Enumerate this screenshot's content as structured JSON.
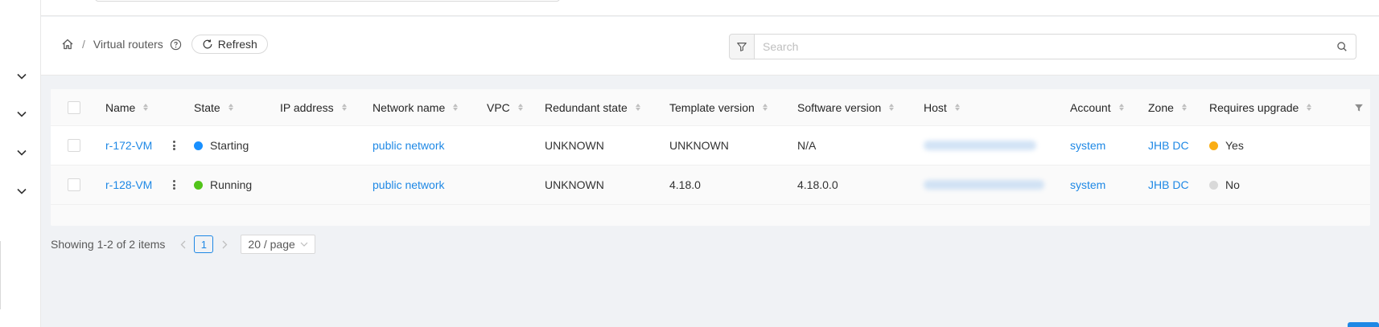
{
  "breadcrumb": {
    "page": "Virtual routers"
  },
  "header": {
    "refresh_label": "Refresh"
  },
  "search": {
    "placeholder": "Search"
  },
  "table": {
    "columns": {
      "name": "Name",
      "state": "State",
      "ip_address": "IP address",
      "network_name": "Network name",
      "vpc": "VPC",
      "redundant_state": "Redundant state",
      "template_version": "Template version",
      "software_version": "Software version",
      "host": "Host",
      "account": "Account",
      "zone": "Zone",
      "requires_upgrade": "Requires upgrade"
    },
    "rows": [
      {
        "name": "r-172-VM",
        "state": "Starting",
        "state_color": "#1890ff",
        "network_name": "public network",
        "redundant_state": "UNKNOWN",
        "template_version": "UNKNOWN",
        "software_version": "N/A",
        "account": "system",
        "zone": "JHB DC",
        "requires_upgrade": "Yes",
        "upgrade_color": "#faad14"
      },
      {
        "name": "r-128-VM",
        "state": "Running",
        "state_color": "#52c41a",
        "network_name": "public network",
        "redundant_state": "UNKNOWN",
        "template_version": "4.18.0",
        "software_version": "4.18.0.0",
        "account": "system",
        "zone": "JHB DC",
        "requires_upgrade": "No",
        "upgrade_color": "#d9d9d9"
      }
    ]
  },
  "pagination": {
    "summary": "Showing 1-2 of 2 items",
    "current_page": "1",
    "page_size": "20 / page"
  },
  "colors": {
    "accent": "#1e88e5"
  }
}
